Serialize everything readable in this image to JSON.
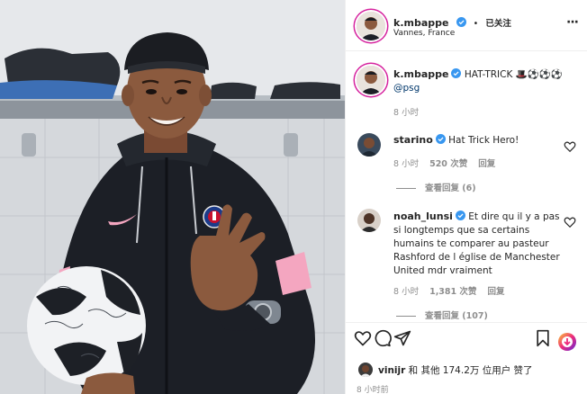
{
  "post": {
    "username": "k.mbappe",
    "location": "Vannes, France",
    "follow_sep": "•",
    "follow_status": "已关注",
    "more": "···"
  },
  "caption": {
    "username": "k.mbappe",
    "text": "HAT-TRICK 🎩⚽⚽⚽",
    "mention": "@psg",
    "time": "8 小时"
  },
  "comments": [
    {
      "username": "starino",
      "text": "Hat Trick Hero!",
      "time": "8 小时",
      "likes": "520 次赞",
      "reply": "回复",
      "view_replies": "查看回复 (6)"
    },
    {
      "username": "noah_lunsi",
      "text": "Et dire qu il y a pas si longtemps que sa certains humains te comparer au pasteur Rashford de l église de Manchester United mdr vraiment",
      "time": "8 小时",
      "likes": "1,381 次赞",
      "reply": "回复",
      "view_replies": "查看回复 (107)"
    }
  ],
  "likes_line": {
    "user": "vinijr",
    "rest": " 和 其他 174.2万 位用户 赞了"
  },
  "post_time": "8 小时前",
  "photo": {
    "jersey_logo": "PARIS SAINT-GERMAIN"
  },
  "icons": {
    "like": "heart-icon",
    "comment": "comment-icon",
    "share": "share-icon",
    "save": "bookmark-icon",
    "more": "more-icon",
    "verified": "verified-badge-icon"
  },
  "colors": {
    "verified": "#3897f0",
    "link": "#00376b",
    "muted": "#8e8e8e",
    "jersey": "#1c1f26",
    "accent_pink": "#f4a6c0"
  }
}
